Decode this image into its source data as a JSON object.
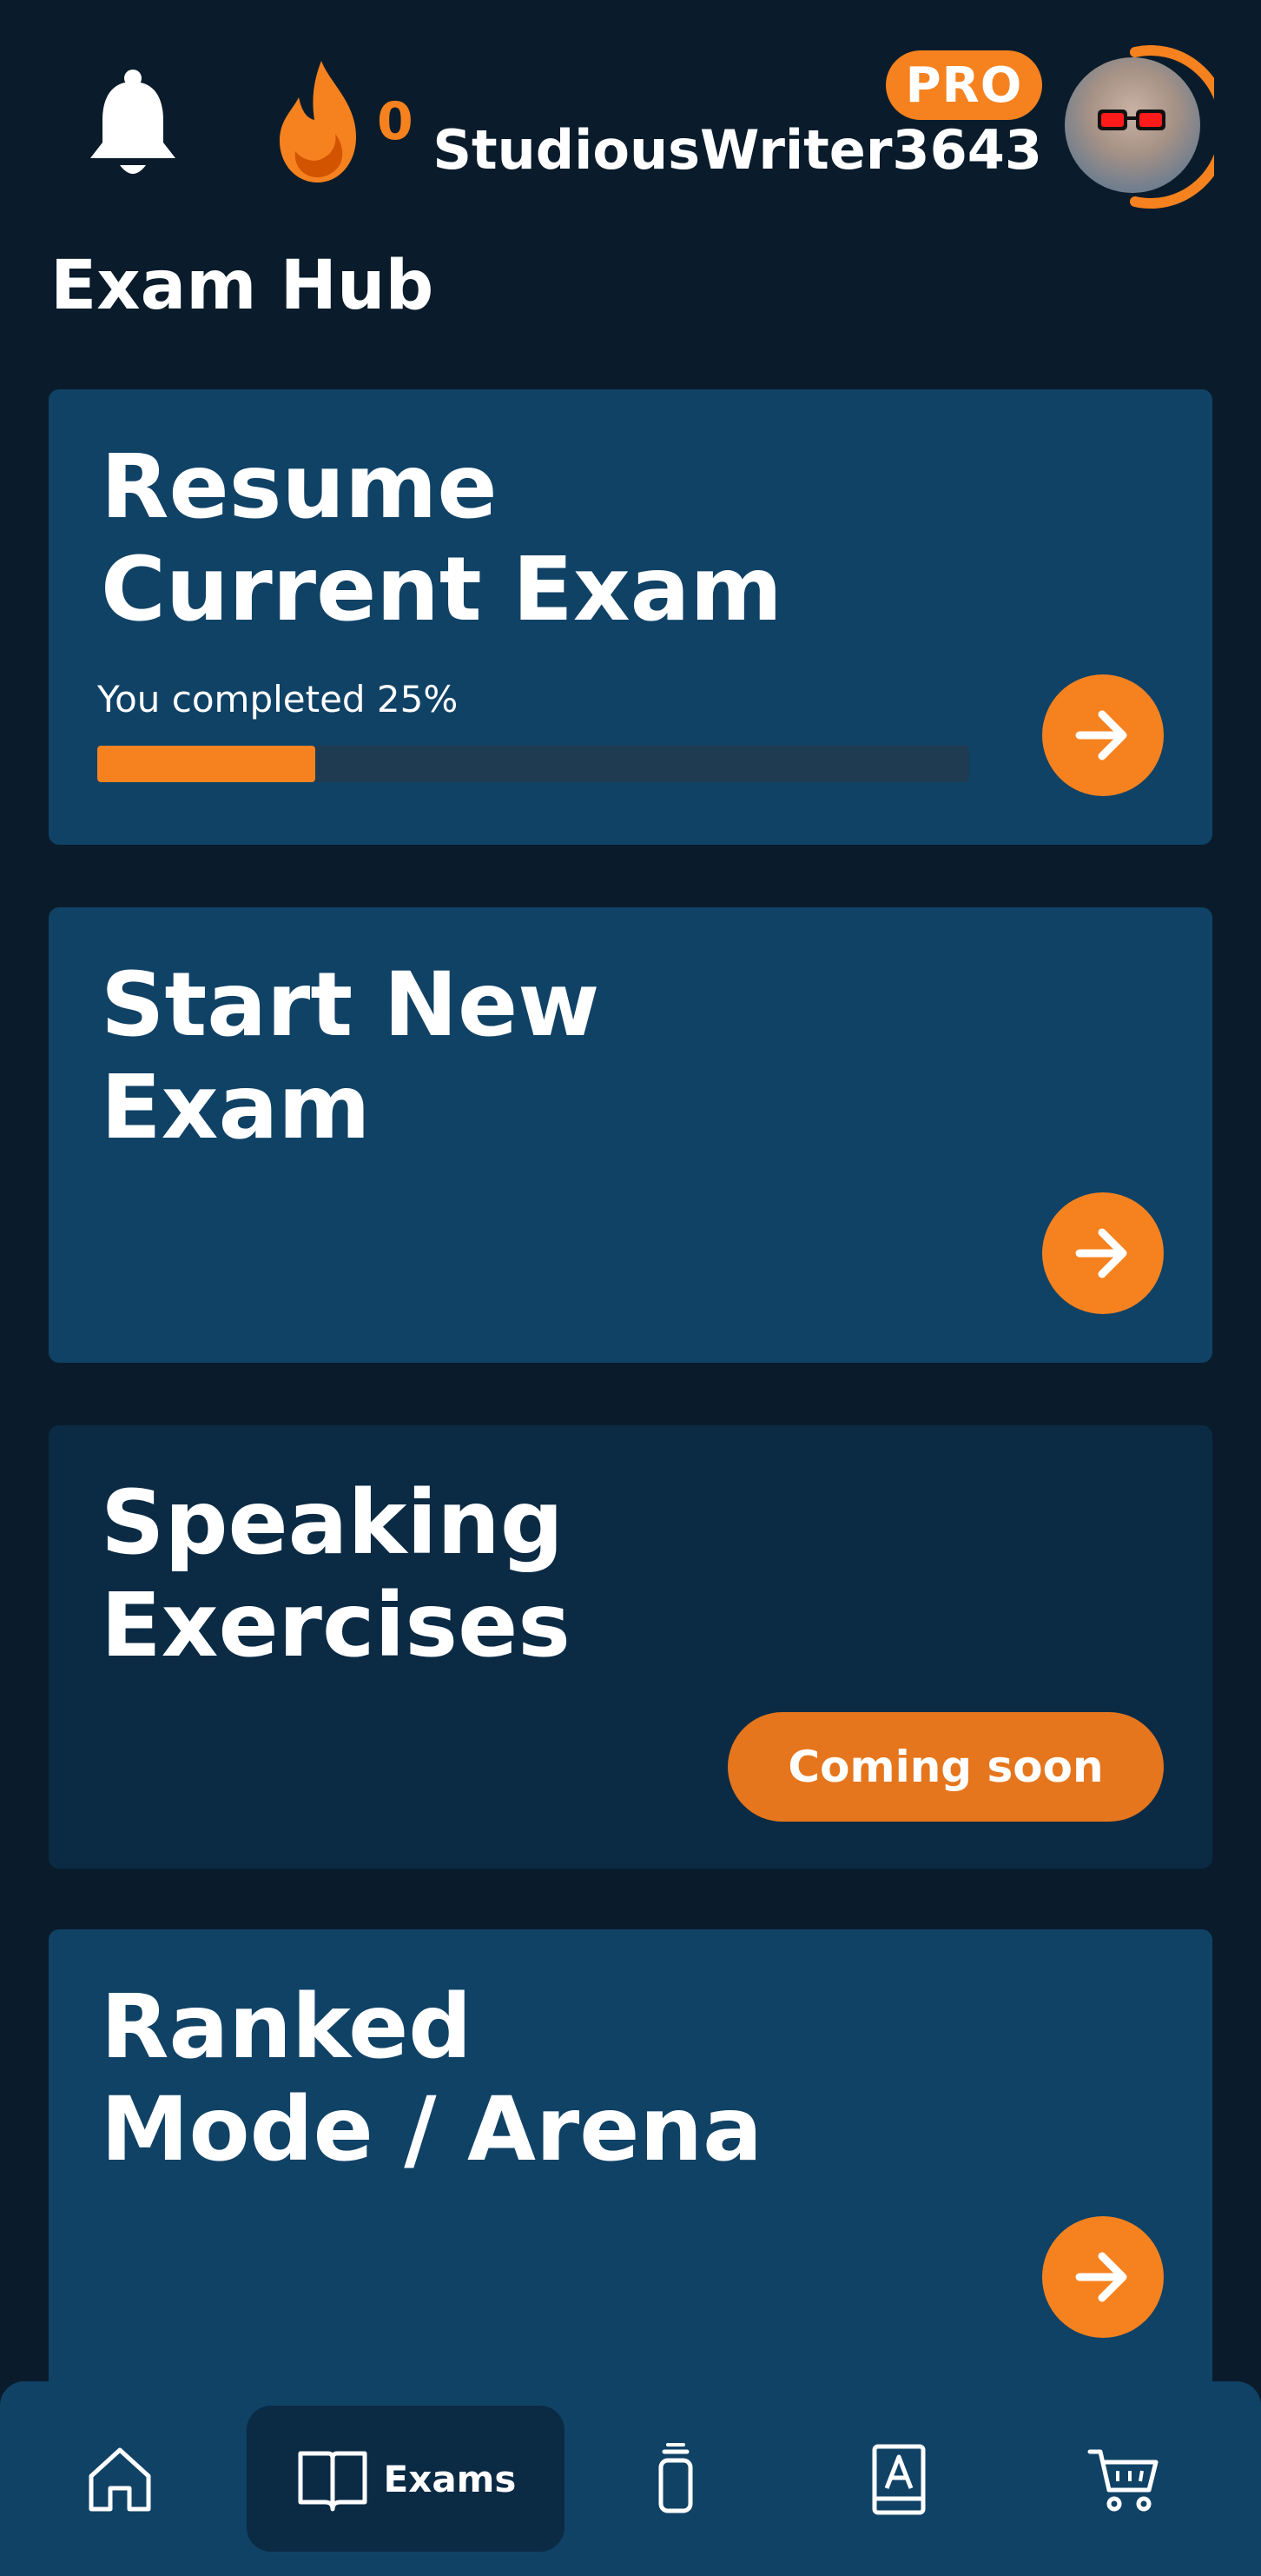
{
  "header": {
    "streak_count": "0",
    "badge": "PRO",
    "username": "StudiousWriter3643",
    "icons": {
      "notifications": "bell-icon",
      "streak": "flame-icon",
      "avatar": "avatar"
    }
  },
  "page": {
    "title": "Exam Hub"
  },
  "cards": {
    "resume": {
      "title": "Resume\nCurrent Exam",
      "progress_label": "You completed 25%",
      "progress": 0.25,
      "icon": "arrow-right-icon"
    },
    "start": {
      "title": "Start New\nExam",
      "icon": "arrow-right-icon"
    },
    "speaking": {
      "title": "Speaking\nExercises",
      "status": "Coming soon"
    },
    "ranked": {
      "title": "Ranked\nMode / Arena",
      "icon": "arrow-right-icon"
    }
  },
  "nav": {
    "items": [
      {
        "icon": "home-icon"
      },
      {
        "icon": "book-icon",
        "label": "Exams",
        "active": true
      },
      {
        "icon": "flashcards-icon"
      },
      {
        "icon": "vocabulary-book-icon"
      },
      {
        "icon": "cart-icon"
      }
    ]
  },
  "colors": {
    "background": "#0a1c2b",
    "card": "#104266",
    "card_muted": "#0b2b45",
    "accent": "#f5821f",
    "text": "#ffffff"
  }
}
